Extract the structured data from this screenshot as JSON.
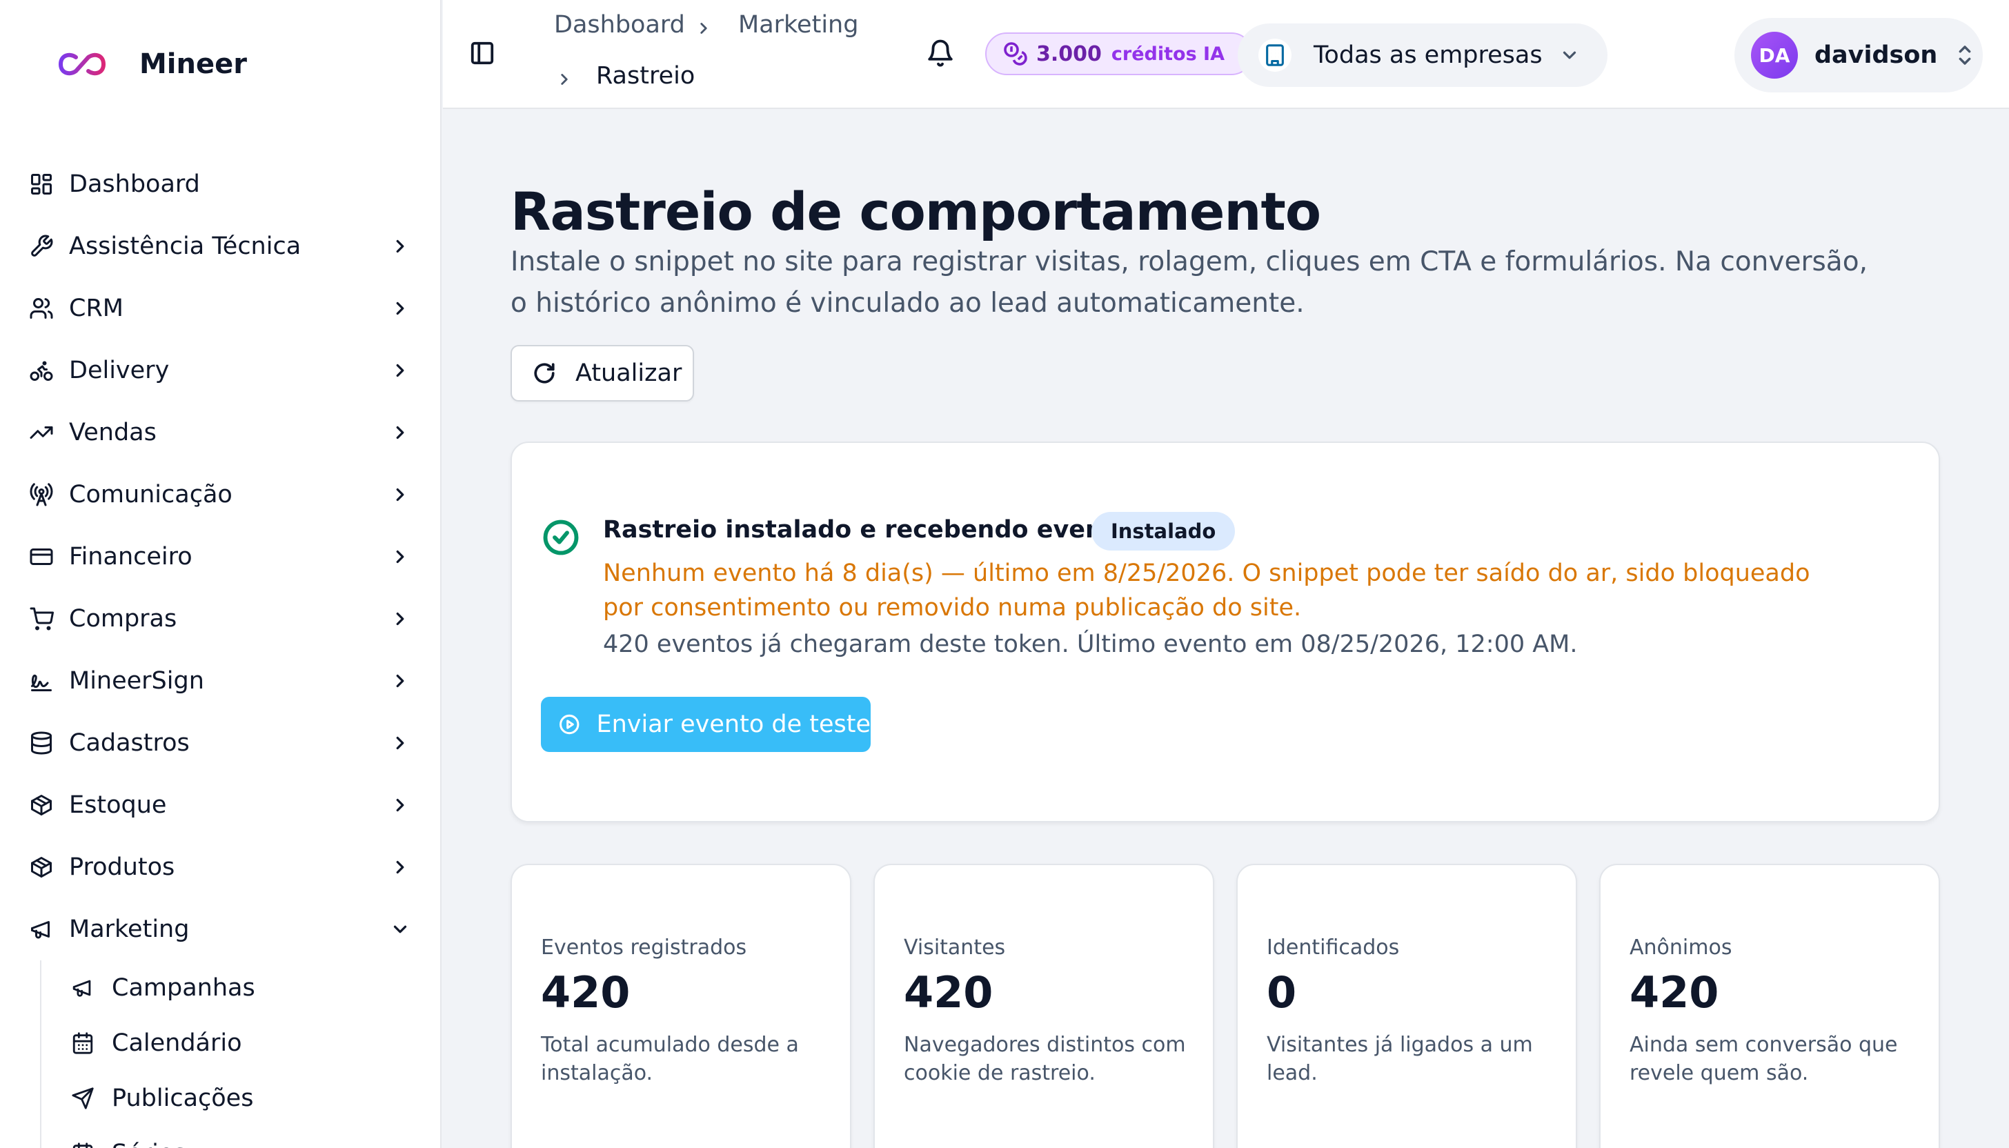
{
  "brand": {
    "name": "Mineer"
  },
  "sidebar": {
    "items": [
      {
        "label": "Dashboard",
        "icon": "dashboard-grid-icon",
        "has_children": false
      },
      {
        "label": "Assistência Técnica",
        "icon": "wrench-icon",
        "has_children": true
      },
      {
        "label": "CRM",
        "icon": "users-icon",
        "has_children": true
      },
      {
        "label": "Delivery",
        "icon": "bike-icon",
        "has_children": true
      },
      {
        "label": "Vendas",
        "icon": "trending-up-icon",
        "has_children": true
      },
      {
        "label": "Comunicação",
        "icon": "broadcast-icon",
        "has_children": true
      },
      {
        "label": "Financeiro",
        "icon": "credit-card-icon",
        "has_children": true
      },
      {
        "label": "Compras",
        "icon": "cart-icon",
        "has_children": true
      },
      {
        "label": "MineerSign",
        "icon": "signature-icon",
        "has_children": true
      },
      {
        "label": "Cadastros",
        "icon": "database-icon",
        "has_children": true
      },
      {
        "label": "Estoque",
        "icon": "package-icon",
        "has_children": true
      },
      {
        "label": "Produtos",
        "icon": "package-icon",
        "has_children": true
      },
      {
        "label": "Marketing",
        "icon": "megaphone-icon",
        "has_children": true,
        "expanded": true
      }
    ],
    "marketing_children": [
      {
        "label": "Campanhas",
        "icon": "megaphone-icon"
      },
      {
        "label": "Calendário",
        "icon": "calendar-icon"
      },
      {
        "label": "Publicações",
        "icon": "send-icon"
      },
      {
        "label": "Séries",
        "icon": "calendar-icon"
      }
    ]
  },
  "header": {
    "breadcrumb": [
      "Dashboard",
      "Marketing",
      "Rastreio"
    ],
    "credits_amount": "3.000",
    "credits_label": "créditos IA",
    "company_selector": "Todas as empresas",
    "user_initials": "DA",
    "user_name": "davidson"
  },
  "main": {
    "title": "Rastreio de comportamento",
    "description": "Instale o snippet no site para registrar visitas, rolagem, cliques em CTA e formulários. Na conversão, o histórico anônimo é vinculado ao lead automaticamente.",
    "refresh_label": "Atualizar",
    "status": {
      "title": "Rastreio instalado e recebendo eventos",
      "badge": "Instalado",
      "warning": "Nenhum evento há 8 dia(s) — último em 8/25/2026. O snippet pode ter saído do ar, sido bloqueado por consentimento ou removido numa publicação do site.",
      "info": "420 eventos já chegaram deste token. Último evento em 08/25/2026, 12:00 AM.",
      "test_button": "Enviar evento de teste"
    },
    "stats": [
      {
        "label": "Eventos registrados",
        "value": "420",
        "desc": "Total acumulado desde a instalação."
      },
      {
        "label": "Visitantes",
        "value": "420",
        "desc": "Navegadores distintos com cookie de rastreio."
      },
      {
        "label": "Identificados",
        "value": "0",
        "desc": "Visitantes já ligados a um lead."
      },
      {
        "label": "Anônimos",
        "value": "420",
        "desc": "Ainda sem conversão que revele quem são."
      }
    ]
  },
  "colors": {
    "accent": "#38bdf8",
    "success": "#059669",
    "warning": "#d97706",
    "credits": "#9333ea",
    "avatar": "#8b5cf6"
  }
}
